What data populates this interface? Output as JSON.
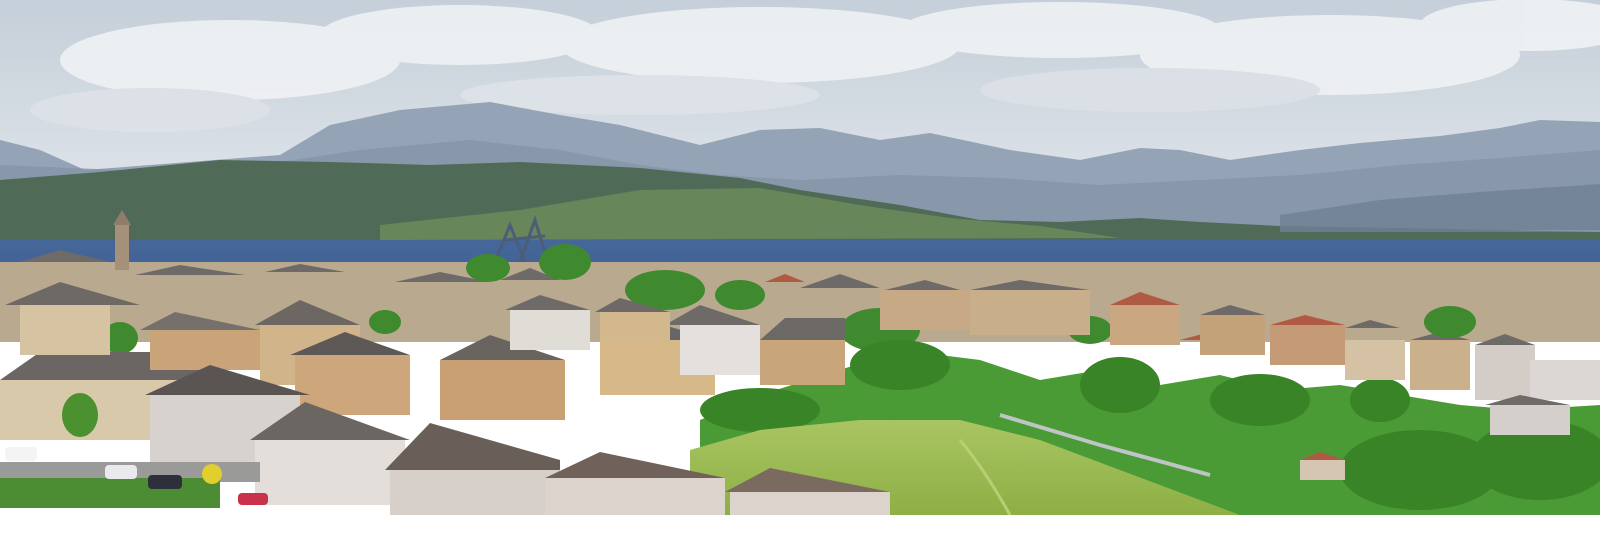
{
  "scene": {
    "description_label": "",
    "elements": [
      "sky",
      "clouds",
      "distant-mountains",
      "far-shore-hills",
      "estuary-water",
      "town-houses",
      "trees",
      "green-hill",
      "church-steeple",
      "shipyard-crane"
    ]
  },
  "colors": {
    "sky_top": "#c9d3dc",
    "sky_bottom": "#e4e8ec",
    "mountain_far": "#8f9db0",
    "mountain_mid": "#7c8aa0",
    "hill_shore": "#4e6a55",
    "water": "#3f5f8f",
    "grass": "#9fbd55",
    "trees": "#3d8a2c",
    "roof_dark": "#5d5a5a",
    "roof_red": "#a3533d",
    "wall_beige": "#d8c4a4",
    "wall_grey": "#cfcaca"
  },
  "stripes": [
    {
      "name": "purple",
      "color": "#3a2f7b"
    },
    {
      "name": "blue",
      "color": "#1f78c8"
    },
    {
      "name": "green",
      "color": "#1f7a32"
    },
    {
      "name": "orange",
      "color": "#e0571e"
    },
    {
      "name": "red",
      "color": "#d6262b"
    }
  ]
}
